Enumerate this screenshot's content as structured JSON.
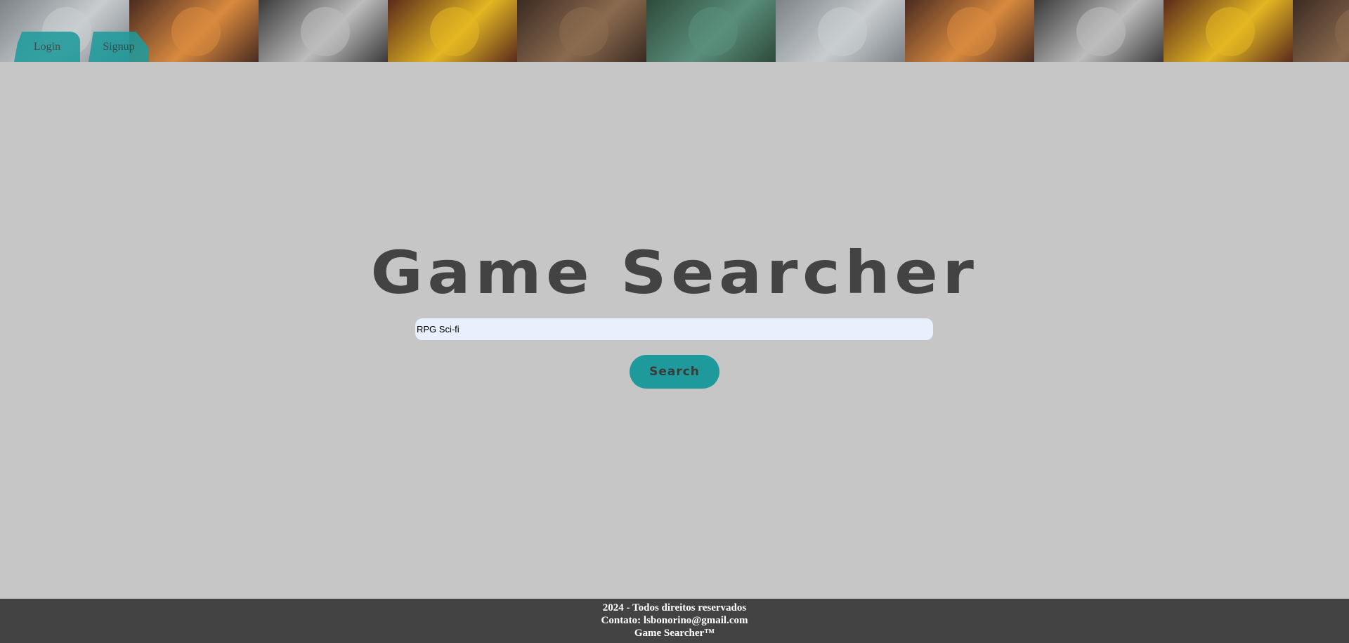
{
  "banner": {
    "tiles": [
      {
        "name": "robot-game-cover",
        "bg": "#7c8287",
        "accent": "#c9cdd0"
      },
      {
        "name": "fire-hero-game-cover",
        "bg": "#4a2b22",
        "accent": "#d98a3e"
      },
      {
        "name": "monochrome-group-game-cover",
        "bg": "#3a3a3a",
        "accent": "#bdbdbd"
      },
      {
        "name": "yellow-character-game-cover",
        "bg": "#5a2a1c",
        "accent": "#e3b622"
      },
      {
        "name": "yakuza-game-cover",
        "bg": "#3b2b22",
        "accent": "#8b6b4f"
      },
      {
        "name": "dragon-map-game-cover",
        "bg": "#2f4a3a",
        "accent": "#5a8f7c"
      }
    ],
    "repeat": 11
  },
  "nav": {
    "login_label": "Login",
    "signup_label": "Signup"
  },
  "main": {
    "title": "Game Searcher",
    "search_value": "RPG Sci-fi",
    "search_button_label": "Search"
  },
  "footer": {
    "line1": "2024 - Todos direitos reservados",
    "line2": "Contato: lsbonorino@gmail.com",
    "line3": "Game Searcher™"
  },
  "colors": {
    "background": "#c6c6c6",
    "accent": "#1f9a9c",
    "footer": "#434343",
    "title": "#434343"
  }
}
